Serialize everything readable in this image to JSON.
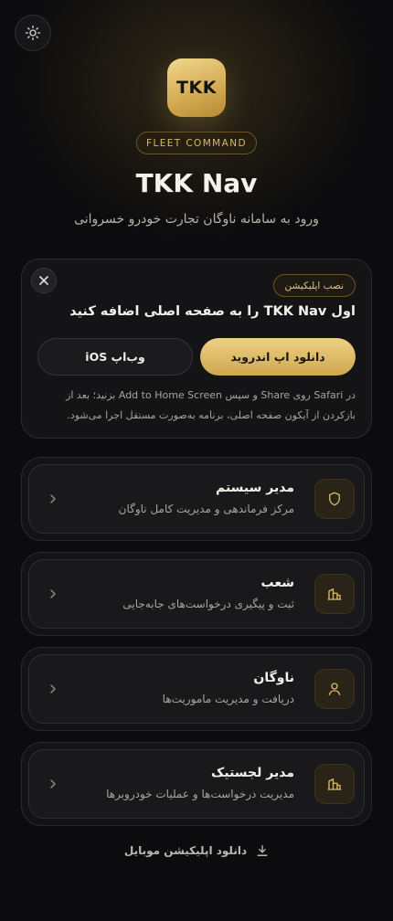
{
  "header": {
    "logo_text": "TKK",
    "badge": "FLEET COMMAND",
    "title": "TKK Nav",
    "subtitle": "ورود به سامانه ناوگان تجارت خودرو خسروانی"
  },
  "install": {
    "tag": "نصب اپلیکیشن",
    "title": "اول TKK Nav را به صفحه اصلی اضافه کنید",
    "android_button": "دانلود اپ اندروید",
    "ios_button": "وب‌اپ iOS",
    "description": "در Safari روی Share و سپس Add to Home Screen بزنید؛ بعد از بازکردن از آیکون صفحه اصلی، برنامه به‌صورت مستقل اجرا می‌شود."
  },
  "roles": [
    {
      "title": "مدیر سیستم",
      "description": "مرکز فرماندهی و مدیریت کامل ناوگان",
      "icon": "shield-icon"
    },
    {
      "title": "شعب",
      "description": "ثبت و پیگیری درخواست‌های جابه‌جایی",
      "icon": "building-icon"
    },
    {
      "title": "ناوگان",
      "description": "دریافت و مدیریت ماموریت‌ها",
      "icon": "user-icon"
    },
    {
      "title": "مدیر لجستیک",
      "description": "مدیریت درخواست‌ها و عملیات خودروبرها",
      "icon": "building-icon"
    }
  ],
  "footer": {
    "download_link": "دانلود اپلیکیشن موبایل"
  },
  "colors": {
    "accent": "#d8b868",
    "background": "#0c0c0e",
    "card": "#141416"
  }
}
